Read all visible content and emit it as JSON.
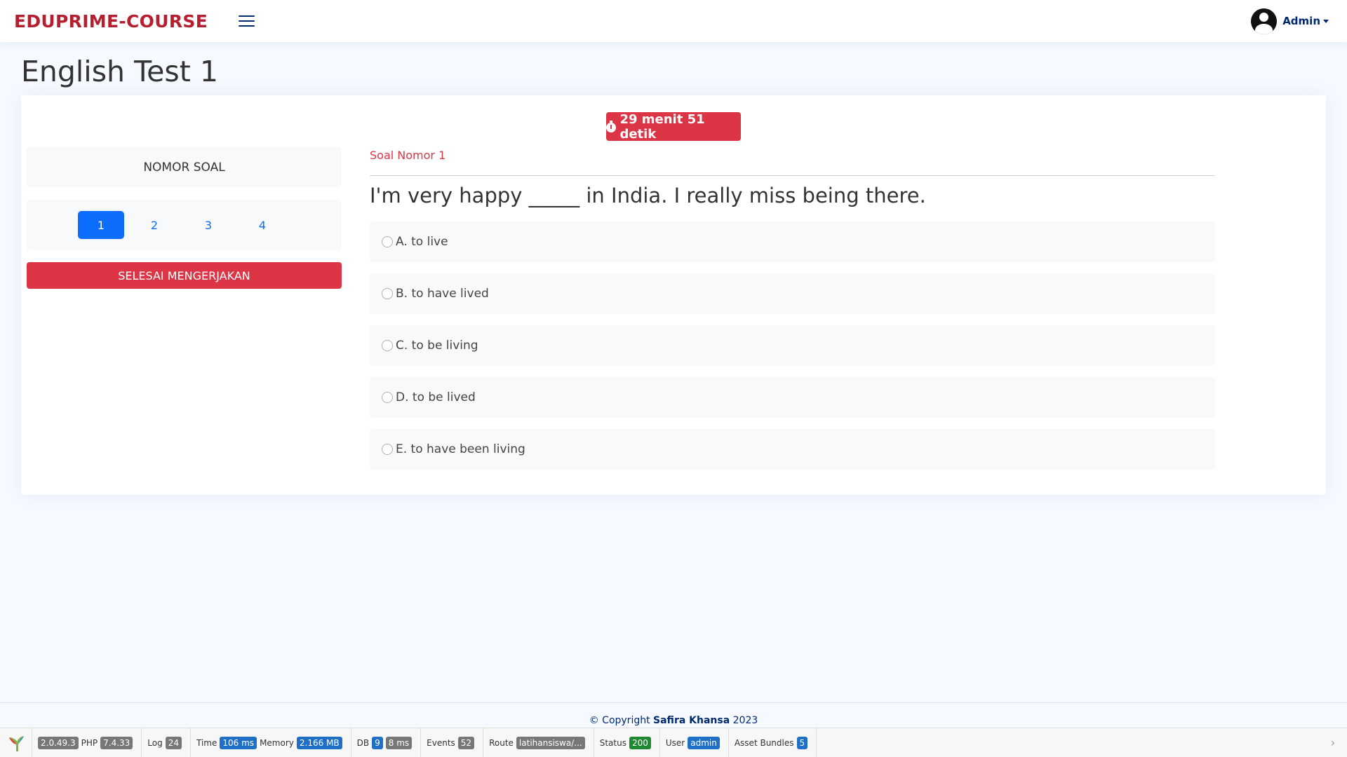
{
  "header": {
    "logo": "EDUPRIME-COURSE",
    "user_name": "Admin"
  },
  "page_title": "English Test 1",
  "timer": "29 menit 51 detik",
  "sidebar": {
    "heading": "NOMOR SOAL",
    "numbers": [
      "1",
      "2",
      "3",
      "4"
    ],
    "active_number": "1",
    "finish_label": "SELESAI MENGERJAKAN"
  },
  "question": {
    "label": "Soal Nomor 1",
    "text": "I'm very happy _____ in India. I really miss being there.",
    "options": [
      "A. to live",
      "B. to have lived",
      "C. to be living",
      "D. to be lived",
      "E. to have been living"
    ]
  },
  "footer": {
    "prefix": "© Copyright ",
    "author": "Safira Khansa",
    "year": " 2023"
  },
  "debug_toolbar": {
    "version": "2.0.49.3",
    "php_label": "PHP",
    "php_version": "7.4.33",
    "log_label": "Log",
    "log_count": "24",
    "time_label": "Time",
    "time_value": "106 ms",
    "memory_label": "Memory",
    "memory_value": "2.166 MB",
    "db_label": "DB",
    "db_count": "9",
    "db_time": "8 ms",
    "events_label": "Events",
    "events_count": "52",
    "route_label": "Route",
    "route_value": "latihansiswa/...",
    "status_label": "Status",
    "status_value": "200",
    "user_label": "User",
    "user_value": "admin",
    "asset_label": "Asset Bundles",
    "asset_count": "5"
  },
  "colors": {
    "brand": "#b51f2f",
    "danger": "#dc3545",
    "primary": "#0d6efd",
    "navy": "#012970"
  }
}
